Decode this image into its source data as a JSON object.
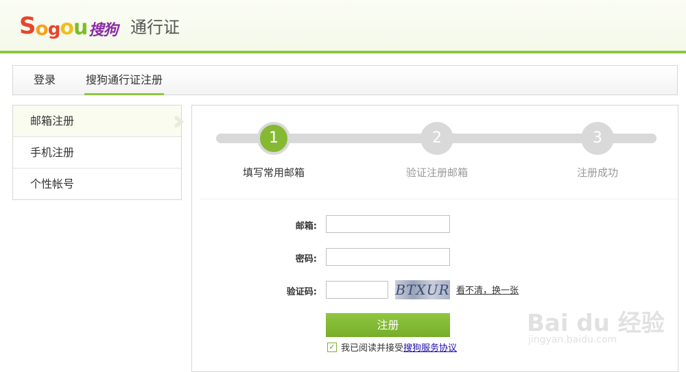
{
  "header": {
    "logo": {
      "s": "S",
      "o1": "o",
      "g": "g",
      "o2": "o",
      "u": "u",
      "cn": "搜狗"
    },
    "title": "通行证",
    "accent_color": "#8cc63f"
  },
  "tabs": [
    {
      "label": "登录",
      "active": false
    },
    {
      "label": "搜狗通行证注册",
      "active": true
    }
  ],
  "sidebar": {
    "items": [
      {
        "label": "邮箱注册",
        "active": true
      },
      {
        "label": "手机注册",
        "active": false
      },
      {
        "label": "个性帐号",
        "active": false
      }
    ],
    "chevron_icon": "chevrons-right-icon"
  },
  "steps": [
    {
      "number": "1",
      "label": "填写常用邮箱",
      "active": true
    },
    {
      "number": "2",
      "label": "验证注册邮箱",
      "active": false
    },
    {
      "number": "3",
      "label": "注册成功",
      "active": false
    }
  ],
  "form": {
    "email_label": "邮箱:",
    "email_value": "",
    "password_label": "密码:",
    "password_value": "",
    "captcha_label": "验证码:",
    "captcha_value": "",
    "captcha_text": "BTXUR",
    "refresh_link": "看不清，换一张",
    "submit_label": "注册",
    "agree_text": "我已阅读并接受",
    "agree_link": "搜狗服务协议",
    "agree_checked": true
  },
  "watermark": {
    "brand": "Bai du 经验",
    "url": "jingyan.baidu.com"
  }
}
